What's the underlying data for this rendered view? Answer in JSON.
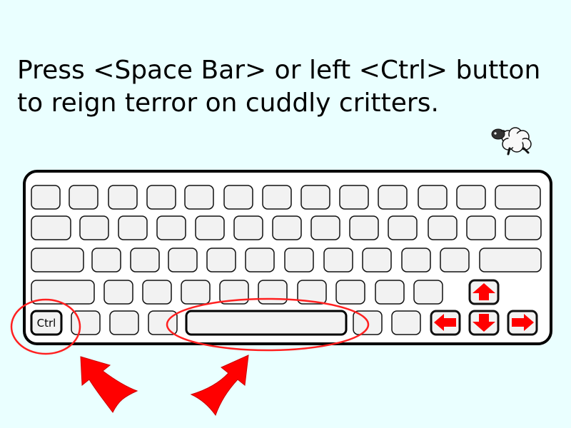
{
  "instructions": {
    "line1": "Press <Space Bar> or left <Ctrl> button",
    "line2": "to reign terror on cuddly critters."
  },
  "keyboard": {
    "ctrl_label": "Ctrl"
  },
  "sprites": {
    "sheep": "sheep-icon"
  },
  "colors": {
    "background": "#eaffff",
    "key_fill": "#f2f2f2",
    "highlight": "#ff0000",
    "outline": "#000000"
  }
}
